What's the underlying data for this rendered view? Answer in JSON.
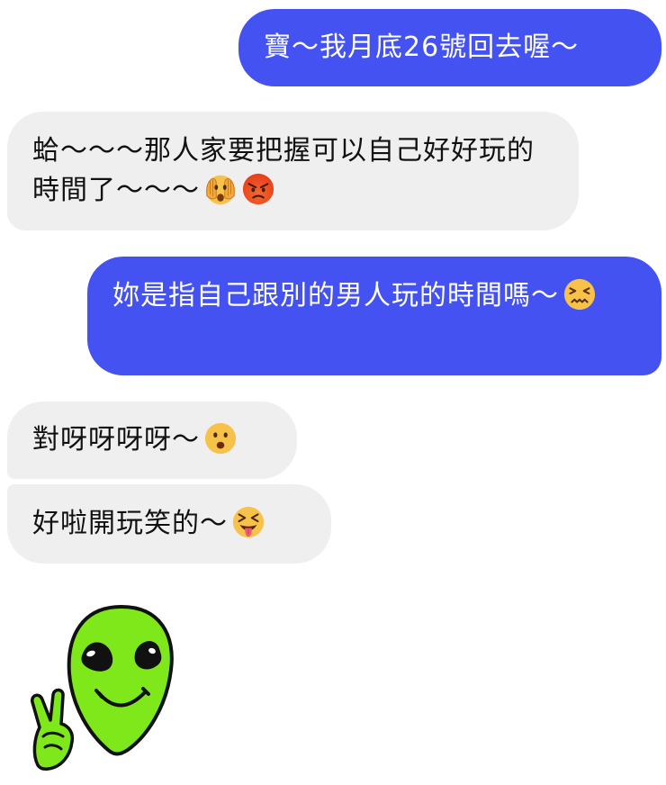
{
  "messages": [
    {
      "id": "m1",
      "sender": "me",
      "text": "寶～我月底26號回去喔～"
    },
    {
      "id": "m2",
      "sender": "them",
      "text": "蛤～～～那人家要把握可以自己好好玩的時間了～～～",
      "emojis": [
        "face-covering-eyes-emoji",
        "angry-face-emoji"
      ]
    },
    {
      "id": "m3",
      "sender": "me",
      "text": "妳是指自己跟別的男人玩的時間嗎～",
      "emojis": [
        "confounded-face-emoji"
      ]
    },
    {
      "id": "m4",
      "sender": "them",
      "text": "對呀呀呀呀～",
      "emojis": [
        "frowning-open-mouth-emoji"
      ]
    },
    {
      "id": "m5",
      "sender": "them",
      "text": "好啦開玩笑的～",
      "emojis": [
        "squinting-tongue-emoji"
      ]
    }
  ],
  "sticker": {
    "name": "alien-peace-sign-sticker"
  },
  "colors": {
    "outgoing_bubble": "#4452f2",
    "incoming_bubble": "#efefef",
    "alien_green": "#7ee81a",
    "emoji_yellow": "#f7c24a",
    "angry_red": "#e8401c"
  }
}
